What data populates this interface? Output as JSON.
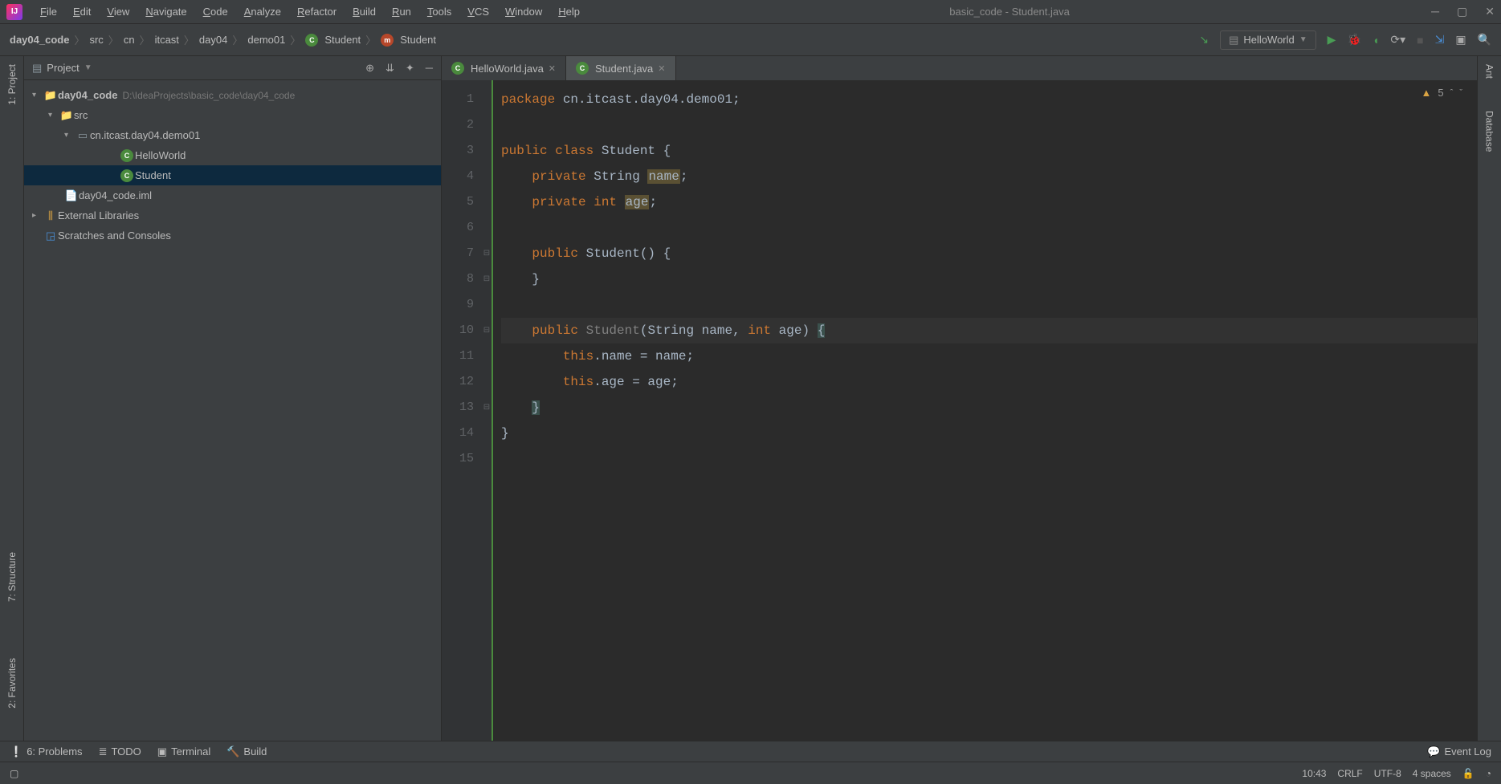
{
  "title": "basic_code - Student.java",
  "menu": [
    "File",
    "Edit",
    "View",
    "Navigate",
    "Code",
    "Analyze",
    "Refactor",
    "Build",
    "Run",
    "Tools",
    "VCS",
    "Window",
    "Help"
  ],
  "breadcrumb": {
    "root": "day04_code",
    "parts": [
      "src",
      "cn",
      "itcast",
      "day04",
      "demo01"
    ],
    "class": "Student",
    "method": "Student"
  },
  "runConfig": "HelloWorld",
  "projectPanel": {
    "title": "Project",
    "root": {
      "name": "day04_code",
      "path": "D:\\IdeaProjects\\basic_code\\day04_code"
    },
    "src": "src",
    "pkg": "cn.itcast.day04.demo01",
    "files": [
      "HelloWorld",
      "Student"
    ],
    "iml": "day04_code.iml",
    "ext": "External Libraries",
    "scratches": "Scratches and Consoles"
  },
  "tabs": [
    {
      "name": "HelloWorld.java",
      "active": false
    },
    {
      "name": "Student.java",
      "active": true
    }
  ],
  "code": {
    "lines": [
      {
        "n": 1,
        "t": [
          {
            "c": "kw",
            "s": "package"
          },
          {
            "s": " cn.itcast.day04.demo01;"
          }
        ]
      },
      {
        "n": 2,
        "t": []
      },
      {
        "n": 3,
        "t": [
          {
            "c": "kw",
            "s": "public class"
          },
          {
            "s": " Student {"
          }
        ]
      },
      {
        "n": 4,
        "t": [
          {
            "s": "    "
          },
          {
            "c": "kw",
            "s": "private"
          },
          {
            "s": " String "
          },
          {
            "c": "hl-field",
            "s": "name"
          },
          {
            "s": ";"
          }
        ]
      },
      {
        "n": 5,
        "t": [
          {
            "s": "    "
          },
          {
            "c": "kw",
            "s": "private int"
          },
          {
            "s": " "
          },
          {
            "c": "hl-field",
            "s": "age"
          },
          {
            "s": ";"
          }
        ]
      },
      {
        "n": 6,
        "t": []
      },
      {
        "n": 7,
        "t": [
          {
            "s": "    "
          },
          {
            "c": "kw",
            "s": "public"
          },
          {
            "s": " Student() {"
          }
        ]
      },
      {
        "n": 8,
        "t": [
          {
            "s": "    }"
          }
        ]
      },
      {
        "n": 9,
        "t": []
      },
      {
        "n": 10,
        "cur": true,
        "t": [
          {
            "s": "    "
          },
          {
            "c": "kw",
            "s": "public"
          },
          {
            "s": " "
          },
          {
            "c": "comment",
            "s": "Student"
          },
          {
            "s": "(String name, "
          },
          {
            "c": "kw",
            "s": "int"
          },
          {
            "s": " age) "
          },
          {
            "c": "hl-brace",
            "s": "{"
          }
        ]
      },
      {
        "n": 11,
        "t": [
          {
            "s": "        "
          },
          {
            "c": "kw",
            "s": "this"
          },
          {
            "s": ".name = name;"
          }
        ]
      },
      {
        "n": 12,
        "t": [
          {
            "s": "        "
          },
          {
            "c": "kw",
            "s": "this"
          },
          {
            "s": ".age = age;"
          }
        ]
      },
      {
        "n": 13,
        "t": [
          {
            "s": "    "
          },
          {
            "c": "hl-brace",
            "s": "}"
          }
        ]
      },
      {
        "n": 14,
        "t": [
          {
            "s": "}"
          }
        ]
      },
      {
        "n": 15,
        "t": []
      }
    ]
  },
  "warnings": "5",
  "leftTools": [
    "1: Project",
    "7: Structure",
    "2: Favorites"
  ],
  "rightTools": [
    "Ant",
    "Database"
  ],
  "bottomTools": {
    "problems": "6: Problems",
    "todo": "TODO",
    "terminal": "Terminal",
    "build": "Build",
    "eventlog": "Event Log"
  },
  "status": {
    "pos": "10:43",
    "sep": "CRLF",
    "enc": "UTF-8",
    "indent": "4 spaces"
  }
}
